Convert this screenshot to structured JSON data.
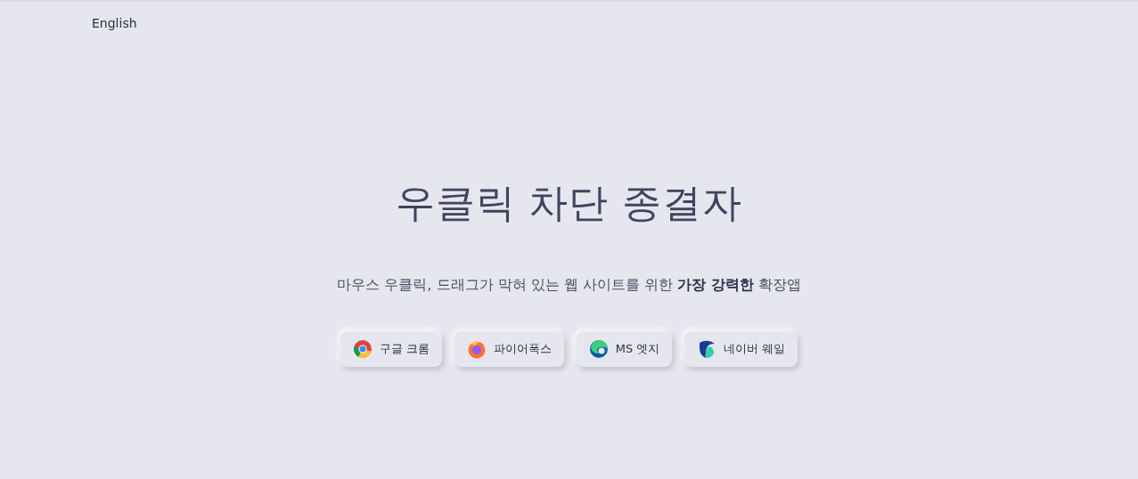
{
  "language_link": "English",
  "title": "우클릭 차단 종결자",
  "subtitle": "마우스 우클릭, 드래그가 막혀 있는 웹 사이트를 위한 **가장 강력한** 확장앱",
  "buttons": [
    {
      "label": "구글 크롬",
      "kind": "chrome"
    },
    {
      "label": "파이어폭스",
      "kind": "firefox"
    },
    {
      "label": "MS 엣지",
      "kind": "edge"
    },
    {
      "label": "네이버 웨일",
      "kind": "whale"
    }
  ]
}
